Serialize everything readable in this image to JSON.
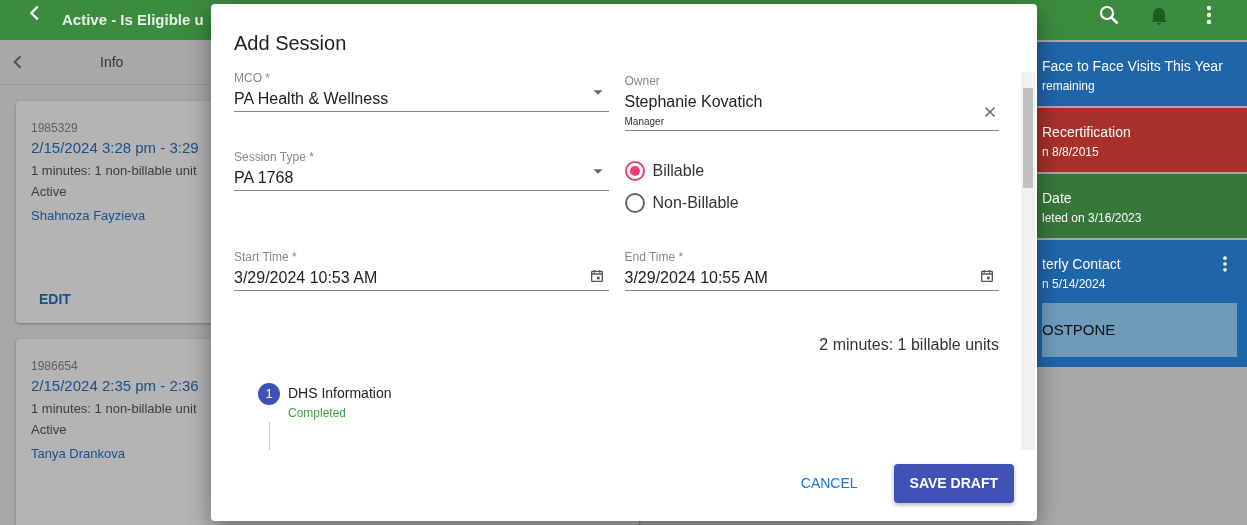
{
  "app_bar": {
    "title": "Active - Is Eligible u"
  },
  "left_panel": {
    "header": "Info",
    "cards": [
      {
        "id": "1985329",
        "time": "2/15/2024 3:28 pm - 3:29",
        "units": "1 minutes: 1 non-billable unit",
        "status": "Active",
        "person": "Shahnoza Fayzieva",
        "action": "EDIT"
      },
      {
        "id": "1986654",
        "time": "2/15/2024 2:35 pm - 2:36",
        "units": "1 minutes: 1 non-billable unit",
        "status": "Active",
        "person": "Tanya Drankova"
      }
    ]
  },
  "right_panel": {
    "cards": [
      {
        "title": "Face to Face Visits This Year",
        "subtitle": "remaining",
        "color": "#1f65aa"
      },
      {
        "title": "Recertification",
        "subtitle": "n 8/8/2015",
        "color": "#a8302a"
      },
      {
        "title": "Date",
        "subtitle": "leted on 3/16/2023",
        "color": "#37773a"
      },
      {
        "title": "terly Contact",
        "subtitle": "n 5/14/2024",
        "color": "#1f65aa",
        "button": "OSTPONE"
      }
    ]
  },
  "dialog": {
    "title": "Add Session",
    "fields": [
      {
        "kind": "select",
        "label": "MCO *",
        "value": "PA Health & Wellness"
      },
      {
        "kind": "person",
        "label": "Owner",
        "value": "Stephanie Kovatich",
        "role": "Manager"
      },
      {
        "kind": "select",
        "label": "Session Type *",
        "value": "PA 1768"
      },
      {
        "kind": "radios",
        "options": [
          {
            "label": "Billable",
            "selected": true
          },
          {
            "label": "Non-Billable",
            "selected": false
          }
        ]
      },
      {
        "kind": "datetime",
        "label": "Start Time *",
        "value": "3/29/2024 10:53 AM"
      },
      {
        "kind": "datetime",
        "label": "End Time *",
        "value": "3/29/2024 10:55 AM"
      }
    ],
    "duration_summary": "2 minutes: 1 billable units",
    "steps": [
      {
        "number": "1",
        "title": "DHS Information",
        "status": "Completed"
      }
    ],
    "buttons": [
      {
        "kind": "text",
        "label": "CANCEL"
      },
      {
        "kind": "primary",
        "label": "SAVE DRAFT"
      }
    ]
  }
}
